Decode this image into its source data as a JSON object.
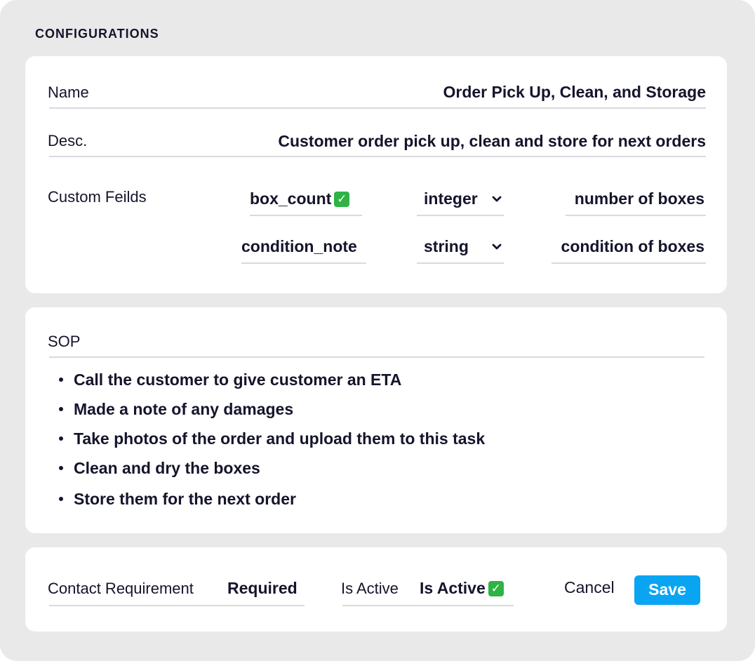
{
  "section_title": "CONFIGURATIONS",
  "config": {
    "name_label": "Name",
    "name_value": "Order Pick Up, Clean, and Storage",
    "desc_label": "Desc.",
    "desc_value": "Customer order pick up, clean and store for next orders",
    "custom_fields_label": "Custom Feilds",
    "custom_fields": [
      {
        "key": "box_count",
        "checked": true,
        "type": "integer",
        "description": "number of boxes"
      },
      {
        "key": "condition_note",
        "checked": false,
        "type": "string",
        "description": "condition of boxes"
      }
    ]
  },
  "sop": {
    "label": "SOP",
    "items": [
      "Call the customer to give customer an ETA",
      "Made a note of any damages",
      "Take photos of the order and upload them to this task",
      "Clean and dry the boxes",
      "Store them for the next order"
    ]
  },
  "footer": {
    "contact_label": "Contact Requirement",
    "contact_value": "Required",
    "active_label": "Is Active",
    "active_value": "Is Active",
    "active_checked": true,
    "cancel_label": "Cancel",
    "save_label": "Save"
  },
  "colors": {
    "background": "#e9e9e9",
    "card": "#ffffff",
    "text": "#14142b",
    "accent": "#0aa5f2",
    "check": "#2fb344",
    "rule": "#d9d9de"
  },
  "icons": {
    "check": "check-mark-icon",
    "dropdown": "chevron-down-icon"
  }
}
